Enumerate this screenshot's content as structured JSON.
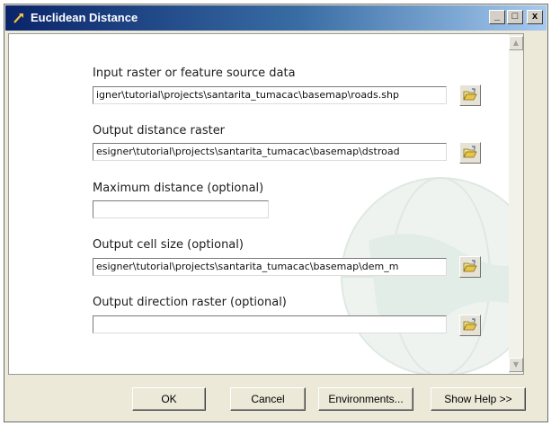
{
  "window": {
    "title": "Euclidean Distance",
    "controls": {
      "minimize": "_",
      "maximize": "□",
      "close": "x"
    }
  },
  "fields": [
    {
      "label": "Input raster or feature source data",
      "value": "igner\\tutorial\\projects\\santarita_tumacac\\basemap\\roads.shp",
      "has_browse": true
    },
    {
      "label": "Output distance raster",
      "value": "esigner\\tutorial\\projects\\santarita_tumacac\\basemap\\dstroad",
      "has_browse": true
    },
    {
      "label": "Maximum distance (optional)",
      "value": "",
      "has_browse": false
    },
    {
      "label": "Output cell size (optional)",
      "value": "esigner\\tutorial\\projects\\santarita_tumacac\\basemap\\dem_m",
      "has_browse": true
    },
    {
      "label": "Output direction raster (optional)",
      "value": "",
      "has_browse": true
    }
  ],
  "buttons": {
    "ok": "OK",
    "cancel": "Cancel",
    "environments": "Environments...",
    "show_help": "Show Help >>"
  },
  "icons": {
    "title": "toolbox-arrow-icon",
    "browse": "open-folder-icon"
  },
  "colors": {
    "titlebar_start": "#0a246a",
    "titlebar_end": "#a6caf0",
    "dialog_background": "#ece9d8"
  }
}
